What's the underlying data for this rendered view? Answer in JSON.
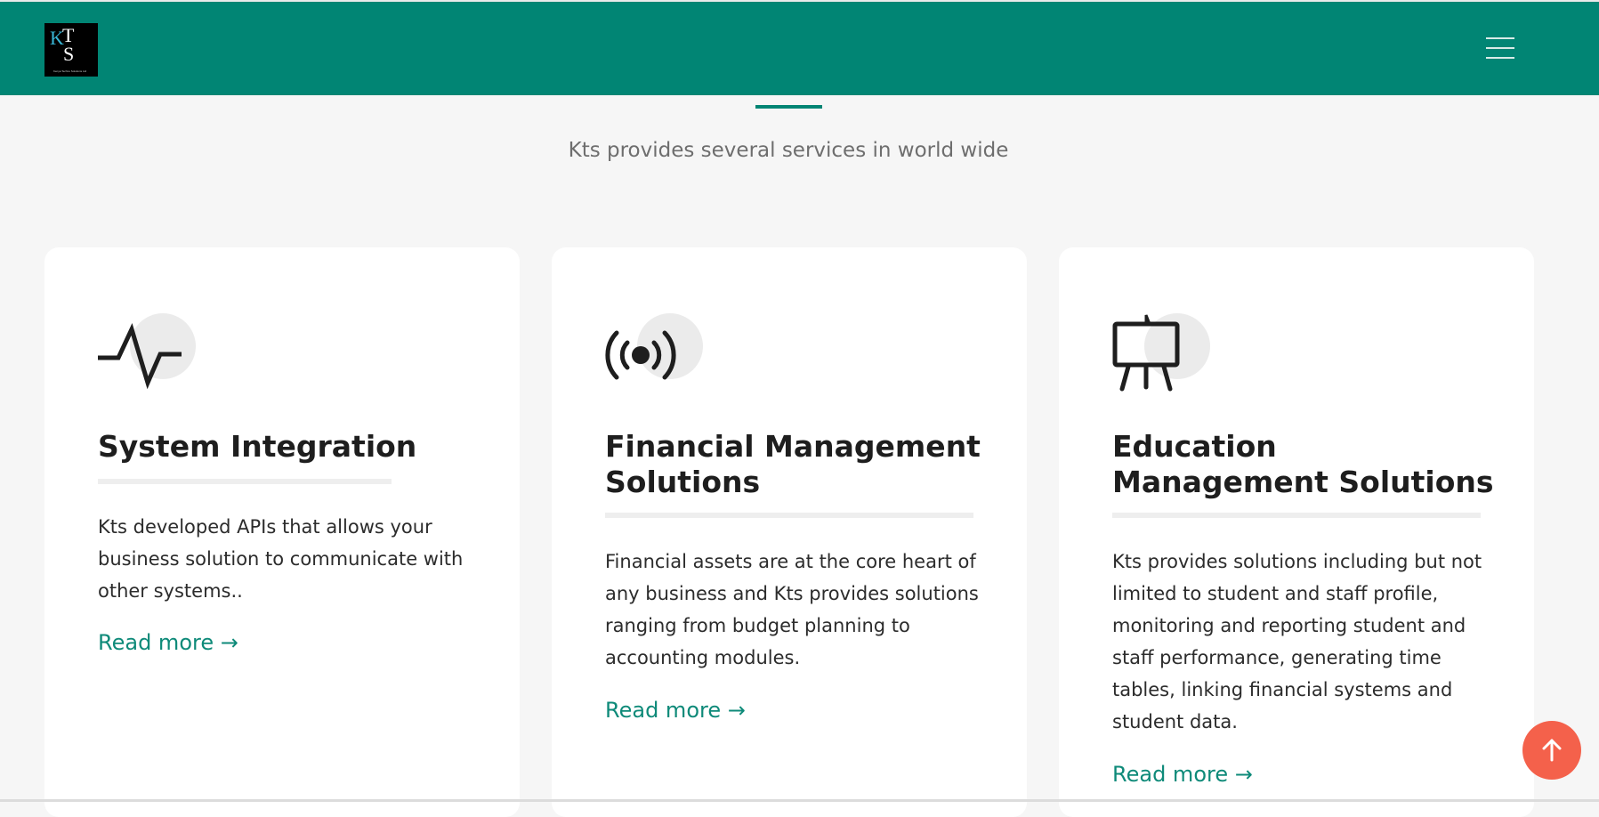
{
  "header": {
    "logo": {
      "letters": [
        "K",
        "T",
        "S"
      ],
      "tagline": "Kenya Techno Solutions Ltd"
    },
    "menu_icon": "hamburger-icon"
  },
  "section": {
    "subtitle": "Kts provides several services in world wide"
  },
  "cards": [
    {
      "icon": "activity-pulse-icon",
      "title": "System Integration",
      "description": "Kts developed APIs that allows your business solution to communicate with other systems..",
      "link": "Read more →"
    },
    {
      "icon": "broadcast-signal-icon",
      "title": "Financial Management Solutions",
      "description": "Financial assets are at the core heart of any business and Kts provides solutions ranging from budget planning to accounting modules.",
      "link": "Read more →"
    },
    {
      "icon": "presentation-easel-icon",
      "title": "Education Management Solutions",
      "description": "Kts provides solutions including but not limited to student and staff profile, monitoring and reporting student and staff performance, generating time tables, linking financial systems and student data.",
      "link": "Read more →"
    }
  ],
  "scroll_top": {
    "icon": "arrow-up-icon"
  },
  "colors": {
    "brand": "#018574",
    "accent": "#f4614b",
    "link": "#0e8a79"
  }
}
